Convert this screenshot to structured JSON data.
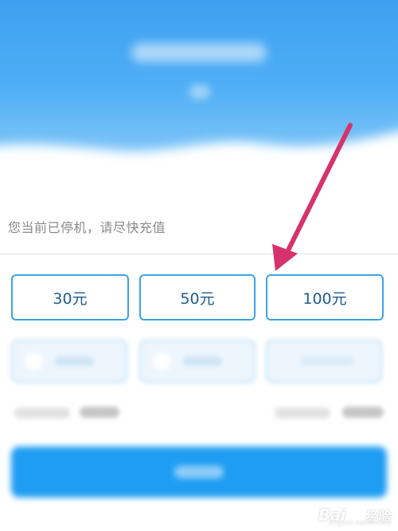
{
  "notice": {
    "text": "您当前已停机，请尽快充值"
  },
  "amounts": {
    "option_30": "30元",
    "option_50": "50元",
    "option_100": "100元"
  },
  "watermark": {
    "brand_a": "Bai",
    "brand_b": "经验",
    "url": "jingyan.baidu.com",
    "paw_icon": "baidu-paw-icon"
  },
  "colors": {
    "header_blue": "#3da2f2",
    "button_border": "#3aa3e6",
    "button_text": "#1f5b8c",
    "arrow": "#d6336c",
    "primary_button": "#1e9df2"
  }
}
